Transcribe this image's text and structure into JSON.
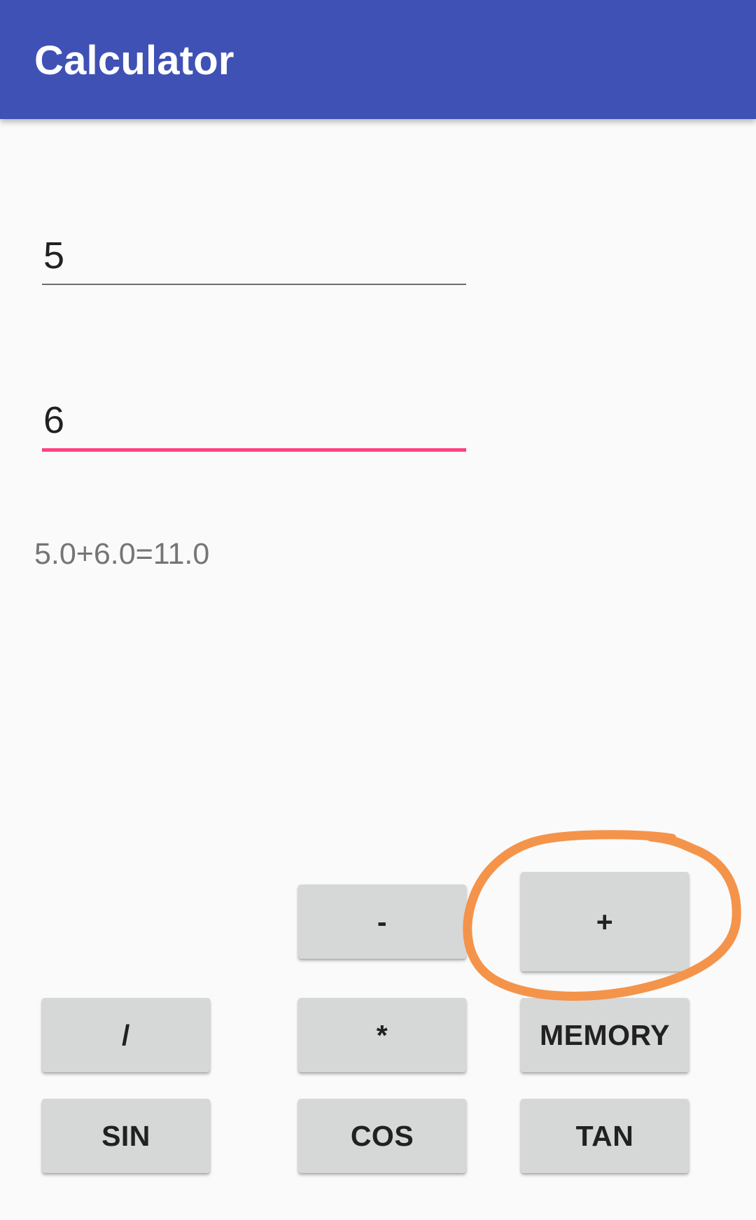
{
  "app_bar": {
    "title": "Calculator",
    "color": "#3f51b5"
  },
  "inputs": {
    "first_value": "5",
    "second_value": "6",
    "focus_accent": "#ff4081"
  },
  "result": {
    "text": "5.0+6.0=11.0"
  },
  "buttons": {
    "minus": "-",
    "plus": "+",
    "divide": "/",
    "multiply": "*",
    "memory": "MEMORY",
    "sin": "SIN",
    "cos": "COS",
    "tan": "TAN"
  },
  "annotation": {
    "shape": "hand-drawn-circle",
    "target": "plus",
    "color": "#f4944a"
  }
}
